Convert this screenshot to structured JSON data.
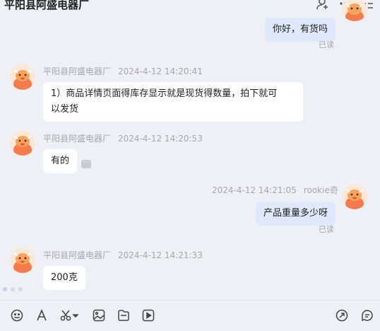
{
  "header": {
    "title": "平阳县阿盛电器厂"
  },
  "messages": [
    {
      "side": "right",
      "text": "你好，有货吗",
      "status": "已读"
    },
    {
      "side": "left",
      "sender": "平阳县阿盛电器厂",
      "time": "2024-4-12 14:20:41",
      "text_line1": "1）商品详情页面得库存显示就是现货得数量，拍下就可",
      "text_line2": "以发货"
    },
    {
      "side": "left",
      "sender": "平阳县阿盛电器厂",
      "time": "2024-4-12 14:20:53",
      "text": "有的",
      "more": "···"
    },
    {
      "side": "right",
      "sender": "rookie奇",
      "time": "2024-4-12 14:21:05",
      "text": "产品重量多少呀",
      "status": "已读"
    },
    {
      "side": "left",
      "sender": "平阳县阿盛电器厂",
      "time": "2024-4-12 14:21:33",
      "text": "200克"
    }
  ],
  "toolbar": {
    "left_tools": [
      "emoji-icon",
      "font-icon",
      "scissors-icon",
      "image-icon",
      "file-icon",
      "video-icon"
    ],
    "right_tools": [
      "share-icon",
      "quick-reply-icon"
    ]
  },
  "colors": {
    "background": "#eef0f5",
    "bubble_mine": "#dfe9fb",
    "bubble_theirs": "#ffffff",
    "avatar": "#f47c4c"
  }
}
